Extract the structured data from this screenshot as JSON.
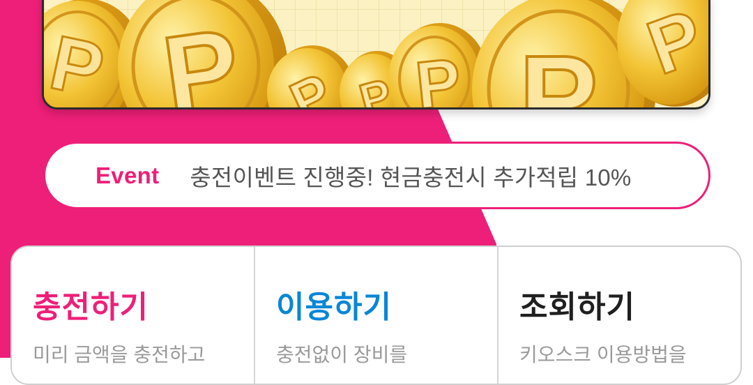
{
  "event": {
    "tag": "Event",
    "text": "충전이벤트 진행중! 현금충전시 추가적립 10%"
  },
  "menu": [
    {
      "title": "충전하기",
      "desc": "미리 금액을 충전하고",
      "color": "#ee1f78"
    },
    {
      "title": "이용하기",
      "desc": "충전없이 장비를",
      "color": "#0a86d6"
    },
    {
      "title": "조회하기",
      "desc": "키오스크 이용방법을",
      "color": "#1f1f1f"
    }
  ],
  "banner": {
    "icon": "gold-point-coins",
    "coin_letter": "P"
  },
  "colors": {
    "brand_pink": "#ee1f78",
    "accent_blue": "#0a86d6",
    "coin_gold": "#f2c12e"
  }
}
